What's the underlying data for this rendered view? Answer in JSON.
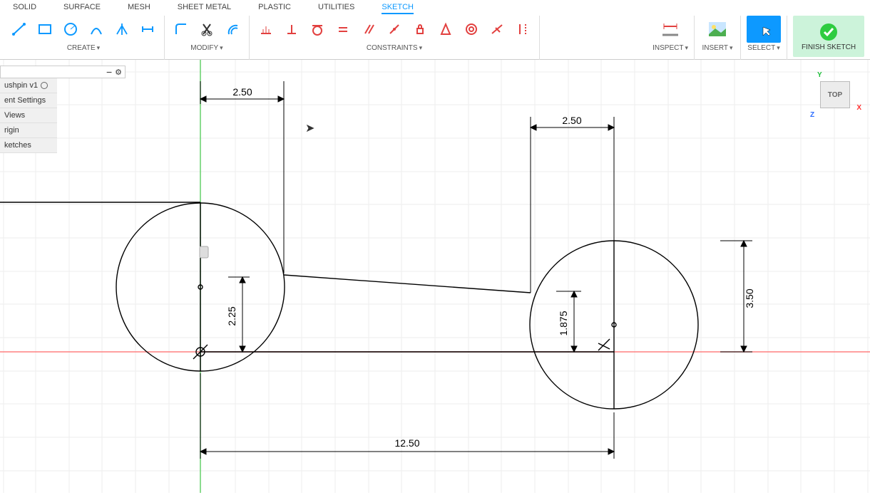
{
  "tabs": {
    "solid": "SOLID",
    "surface": "SURFACE",
    "mesh": "MESH",
    "sheetmetal": "SHEET METAL",
    "plastic": "PLASTIC",
    "utilities": "UTILITIES",
    "sketch": "SKETCH"
  },
  "groups": {
    "create": "CREATE",
    "modify": "MODIFY",
    "constraints": "CONSTRAINTS",
    "inspect": "INSPECT",
    "insert": "INSERT",
    "select": "SELECT",
    "finish": "FINISH SKETCH"
  },
  "browser": {
    "root": "ushpin v1",
    "items": [
      "ent Settings",
      "Views",
      "rigin",
      "ketches"
    ]
  },
  "viewcube": {
    "face": "TOP",
    "axes": {
      "x": "X",
      "y": "Y",
      "z": "Z"
    }
  },
  "dimensions": {
    "d1": "2.50",
    "d2": "2.50",
    "d3": "2.25",
    "d4": "1.875",
    "d5": "3.50",
    "d6": "12.50"
  }
}
